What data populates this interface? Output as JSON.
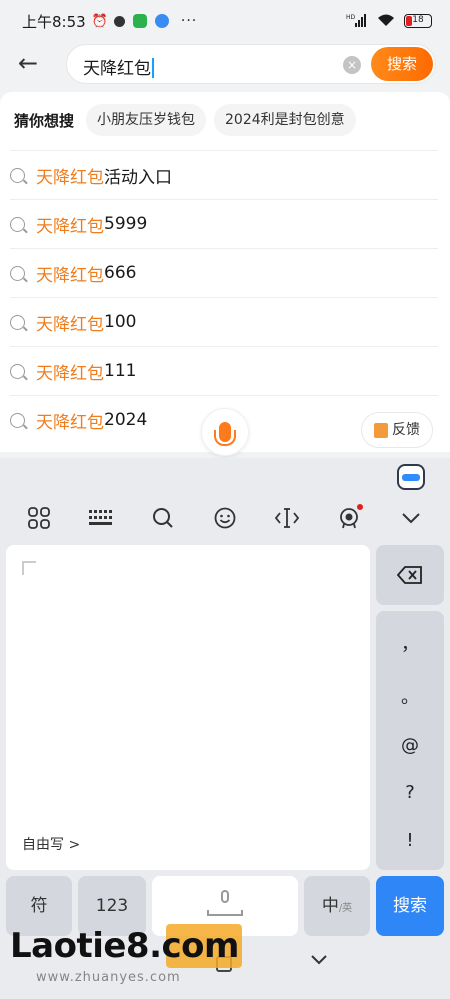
{
  "status_bar": {
    "time": "上午8:53",
    "more": "···",
    "network": "HD",
    "battery": "18"
  },
  "search": {
    "back_label": "←",
    "query": "天降红包",
    "clear_label": "×",
    "button_label": "搜索"
  },
  "suggestions": {
    "guess_label": "猜你想搜",
    "chips": [
      "小朋友压岁钱包",
      "2024利是封包创意"
    ],
    "items": [
      {
        "highlight": "天降红包",
        "rest": "活动入口"
      },
      {
        "highlight": "天降红包",
        "rest": "5999"
      },
      {
        "highlight": "天降红包",
        "rest": "666"
      },
      {
        "highlight": "天降红包",
        "rest": "100"
      },
      {
        "highlight": "天降红包",
        "rest": "111"
      },
      {
        "highlight": "天降红包",
        "rest": "2024"
      }
    ]
  },
  "feedback": {
    "label": "反馈"
  },
  "keyboard": {
    "handwriting_label": "自由写 >",
    "punctuation": [
      "，",
      "。",
      "@",
      "?",
      "!"
    ],
    "keys": {
      "symbol": "符",
      "numbers": "123",
      "lang_main": "中",
      "lang_sub": "/英",
      "enter": "搜索"
    }
  },
  "watermark": {
    "main": "Laotie8.com",
    "sub": "www.zhuanyes.com"
  }
}
